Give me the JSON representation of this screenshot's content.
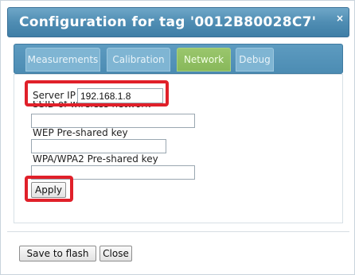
{
  "dialog": {
    "title": "Configuration for tag '0012B80028C7'",
    "close_label": "×"
  },
  "tabs": [
    {
      "label": "Measurements",
      "active": false
    },
    {
      "label": "Calibration",
      "active": false
    },
    {
      "label": "Network",
      "active": true
    },
    {
      "label": "Debug",
      "active": false
    }
  ],
  "network": {
    "server_ip_label": "Server IP",
    "server_ip_value": "192.168.1.8",
    "ssid_label": "SSID of wireless network",
    "wep_label": "WEP Pre-shared key",
    "wpa_label": "WPA/WPA2 Pre-shared key",
    "apply_label": "Apply"
  },
  "footer": {
    "save_label": "Save to flash",
    "close_label": "Close"
  },
  "colors": {
    "title_bar": "#4f8db3",
    "active_tab": "#88b85a",
    "highlight": "#e0202a"
  }
}
